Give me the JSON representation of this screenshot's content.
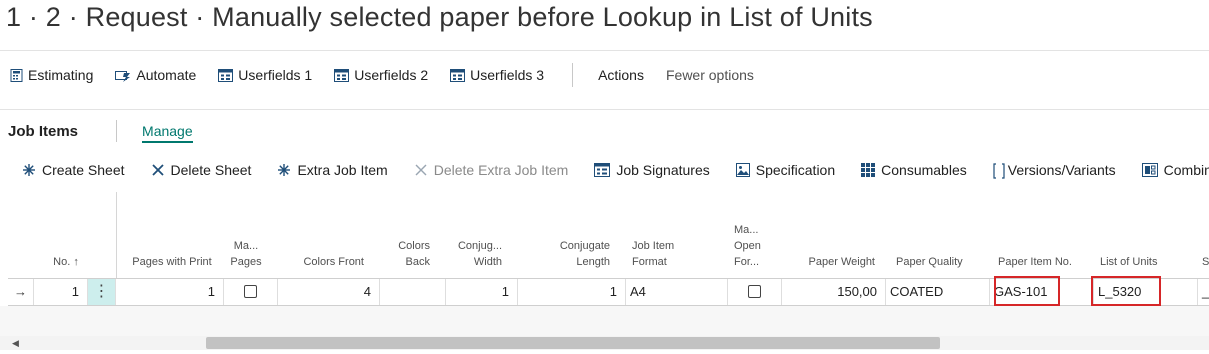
{
  "page": {
    "title": "1 · 2 · Request · Manually selected paper before Lookup in List of Units"
  },
  "action_bar": {
    "items": [
      {
        "label": "Estimating",
        "icon": "calculator-icon"
      },
      {
        "label": "Automate",
        "icon": "automate-icon"
      },
      {
        "label": "Userfields 1",
        "icon": "userfields-icon"
      },
      {
        "label": "Userfields 2",
        "icon": "userfields-icon"
      },
      {
        "label": "Userfields 3",
        "icon": "userfields-icon"
      }
    ],
    "actions_label": "Actions",
    "fewer_options_label": "Fewer options"
  },
  "part": {
    "title": "Job Items",
    "tab_manage": "Manage",
    "actions": [
      {
        "label": "Create Sheet",
        "icon": "create-sheet-icon"
      },
      {
        "label": "Delete Sheet",
        "icon": "delete-icon"
      },
      {
        "label": "Extra Job Item",
        "icon": "extra-item-icon"
      },
      {
        "label": "Delete Extra Job Item",
        "icon": "delete-icon",
        "disabled": true
      },
      {
        "label": "Job Signatures",
        "icon": "signatures-icon"
      },
      {
        "label": "Specification",
        "icon": "image-icon"
      },
      {
        "label": "Consumables",
        "icon": "grid-icon"
      },
      {
        "label": "Versions/Variants",
        "icon": "brackets-icon"
      },
      {
        "label": "Combine",
        "icon": "combine-icon"
      }
    ]
  },
  "grid": {
    "headers": {
      "no": "No. ↑",
      "pages_with_print": "Pages with Print",
      "ma_pages": "Ma... Pages",
      "colors_front": "Colors Front",
      "colors_back": "Colors Back",
      "conjug_width": "Conjug... Width",
      "conjugate_length": "Conjugate Length",
      "job_item_format": "Job Item Format",
      "ma_open_for": "Ma... Open For...",
      "paper_weight": "Paper Weight",
      "paper_quality": "Paper Quality",
      "paper_item_no": "Paper Item No.",
      "list_of_units": "List of Units",
      "s": "S"
    },
    "row": {
      "arrow": "→",
      "no": "1",
      "menu": "⋮",
      "pages_with_print": "1",
      "ma_pages_checked": false,
      "colors_front": "4",
      "colors_back": "",
      "conjug_width": "1",
      "conjugate_length": "1",
      "job_item_format": "A4",
      "ma_open_for_checked": false,
      "paper_weight": "150,00",
      "paper_quality": "COATED",
      "paper_item_no": "GAS-101",
      "list_of_units": "L_5320",
      "s": "_"
    }
  },
  "colors": {
    "accent": "#00786e",
    "highlight_box": "#d62628",
    "row_menu_bg": "#cdeeed"
  }
}
